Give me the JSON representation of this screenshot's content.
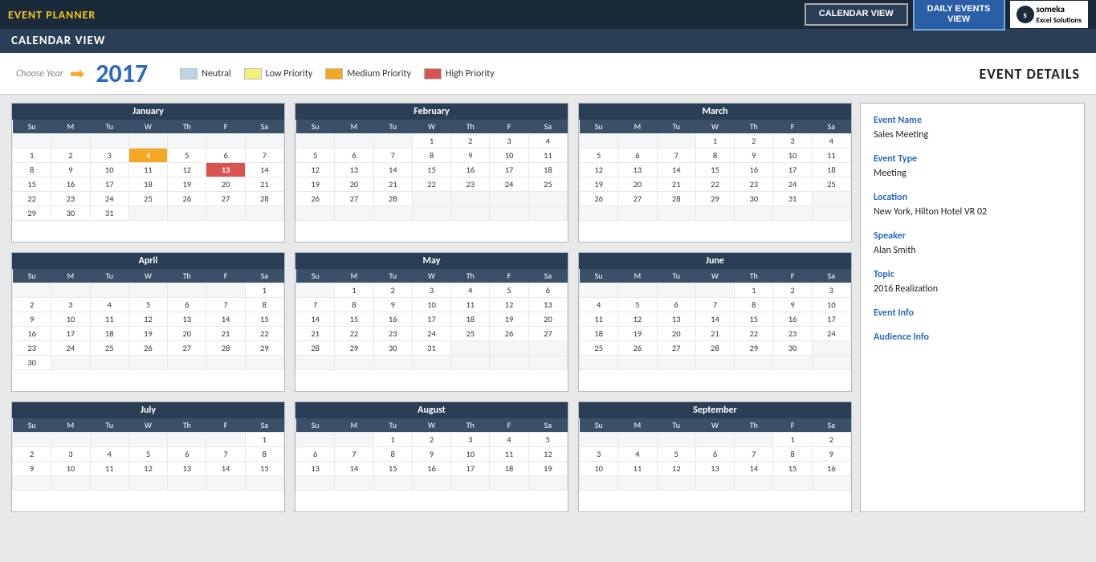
{
  "header": {
    "app_title": "EVENT PLANNER",
    "view_label": "CALENDAR VIEW",
    "btn_calendar": "CALENDAR VIEW",
    "btn_daily": "DAILY EVENTS\nVIEW",
    "logo_text": "someka",
    "logo_sub": "Excel Solutions"
  },
  "toolbar": {
    "choose_year_label": "Choose Year",
    "year": "2017",
    "legend": [
      {
        "key": "neutral",
        "label": "Neutral",
        "color": "#bcd4e6"
      },
      {
        "key": "low_priority",
        "label": "Low Priority",
        "color": "#f5f07a"
      },
      {
        "key": "medium_priority",
        "label": "Medium Priority",
        "color": "#f5a623"
      },
      {
        "key": "high_priority",
        "label": "High Priority",
        "color": "#d9534f"
      }
    ],
    "event_details_title": "EVENT DETAILS"
  },
  "months": [
    {
      "name": "January",
      "days": [
        [
          "",
          "",
          "",
          "",
          "",
          "",
          ""
        ],
        [
          "1",
          "2",
          "3",
          "4",
          "5",
          "6",
          "7"
        ],
        [
          "8",
          "9",
          "10",
          "11",
          "12",
          "13",
          "14"
        ],
        [
          "15",
          "16",
          "17",
          "18",
          "19",
          "20",
          "21"
        ],
        [
          "22",
          "23",
          "24",
          "25",
          "26",
          "27",
          "28"
        ],
        [
          "29",
          "30",
          "31",
          "",
          "",
          "",
          ""
        ]
      ],
      "highlights": {
        "4": "orange",
        "13": "red"
      }
    },
    {
      "name": "February",
      "days": [
        [
          "",
          "",
          "",
          "1",
          "2",
          "3",
          "4"
        ],
        [
          "5",
          "6",
          "7",
          "8",
          "9",
          "10",
          "11"
        ],
        [
          "12",
          "13",
          "14",
          "15",
          "16",
          "17",
          "18"
        ],
        [
          "19",
          "20",
          "21",
          "22",
          "23",
          "24",
          "25"
        ],
        [
          "26",
          "27",
          "28",
          "",
          "",
          "",
          ""
        ],
        [
          "",
          "",
          "",
          "",
          "",
          "",
          ""
        ]
      ],
      "highlights": {}
    },
    {
      "name": "March",
      "days": [
        [
          "",
          "",
          "",
          "1",
          "2",
          "3",
          "4"
        ],
        [
          "5",
          "6",
          "7",
          "8",
          "9",
          "10",
          "11"
        ],
        [
          "12",
          "13",
          "14",
          "15",
          "16",
          "17",
          "18"
        ],
        [
          "19",
          "20",
          "21",
          "22",
          "23",
          "24",
          "25"
        ],
        [
          "26",
          "27",
          "28",
          "29",
          "30",
          "31",
          ""
        ],
        [
          "",
          "",
          "",
          "",
          "",
          "",
          ""
        ]
      ],
      "highlights": {}
    },
    {
      "name": "April",
      "days": [
        [
          "",
          "",
          "",
          "",
          "",
          "",
          "1"
        ],
        [
          "2",
          "3",
          "4",
          "5",
          "6",
          "7",
          "8"
        ],
        [
          "9",
          "10",
          "11",
          "12",
          "13",
          "14",
          "15"
        ],
        [
          "16",
          "17",
          "18",
          "19",
          "20",
          "21",
          "22"
        ],
        [
          "23",
          "24",
          "25",
          "26",
          "27",
          "28",
          "29"
        ],
        [
          "30",
          "",
          "",
          "",
          "",
          "",
          ""
        ]
      ],
      "highlights": {}
    },
    {
      "name": "May",
      "days": [
        [
          "",
          "1",
          "2",
          "3",
          "4",
          "5",
          "6"
        ],
        [
          "7",
          "8",
          "9",
          "10",
          "11",
          "12",
          "13"
        ],
        [
          "14",
          "15",
          "16",
          "17",
          "18",
          "19",
          "20"
        ],
        [
          "21",
          "22",
          "23",
          "24",
          "25",
          "26",
          "27"
        ],
        [
          "28",
          "29",
          "30",
          "31",
          "",
          "",
          ""
        ],
        [
          "",
          "",
          "",
          "",
          "",
          "",
          ""
        ]
      ],
      "highlights": {}
    },
    {
      "name": "June",
      "days": [
        [
          "",
          "",
          "",
          "",
          "1",
          "2",
          "3"
        ],
        [
          "4",
          "5",
          "6",
          "7",
          "8",
          "9",
          "10"
        ],
        [
          "11",
          "12",
          "13",
          "14",
          "15",
          "16",
          "17"
        ],
        [
          "18",
          "19",
          "20",
          "21",
          "22",
          "23",
          "24"
        ],
        [
          "25",
          "26",
          "27",
          "28",
          "29",
          "30",
          ""
        ],
        [
          "",
          "",
          "",
          "",
          "",
          "",
          ""
        ]
      ],
      "highlights": {}
    },
    {
      "name": "July",
      "days": [
        [
          "",
          "",
          "",
          "",
          "",
          "",
          "1"
        ],
        [
          "2",
          "3",
          "4",
          "5",
          "6",
          "7",
          "8"
        ],
        [
          "9",
          "10",
          "11",
          "12",
          "13",
          "14",
          "15"
        ],
        [
          "",
          "",
          "",
          "",
          "",
          "",
          ""
        ]
      ],
      "highlights": {}
    },
    {
      "name": "August",
      "days": [
        [
          "",
          "",
          "1",
          "2",
          "3",
          "4",
          "5"
        ],
        [
          "6",
          "7",
          "8",
          "9",
          "10",
          "11",
          "12"
        ],
        [
          "13",
          "14",
          "15",
          "16",
          "17",
          "18",
          "19"
        ],
        [
          "",
          "",
          "",
          "",
          "",
          "",
          ""
        ]
      ],
      "highlights": {}
    },
    {
      "name": "September",
      "days": [
        [
          "",
          "",
          "",
          "",
          "",
          "1",
          "2"
        ],
        [
          "3",
          "4",
          "5",
          "6",
          "7",
          "8",
          "9"
        ],
        [
          "10",
          "11",
          "12",
          "13",
          "14",
          "15",
          "16"
        ],
        [
          "",
          "",
          "",
          "",
          "",
          "",
          ""
        ]
      ],
      "highlights": {}
    }
  ],
  "event_details": {
    "name_label": "Event Name",
    "name_value": "Sales Meeting",
    "type_label": "Event Type",
    "type_value": "Meeting",
    "location_label": "Location",
    "location_value": "New York, Hilton Hotel VR 02",
    "speaker_label": "Speaker",
    "speaker_value": "Alan Smith",
    "topic_label": "Topic",
    "topic_value": "2016 Realization",
    "event_info_label": "Event Info",
    "event_info_value": "",
    "audience_info_label": "Audience Info",
    "audience_info_value": ""
  }
}
